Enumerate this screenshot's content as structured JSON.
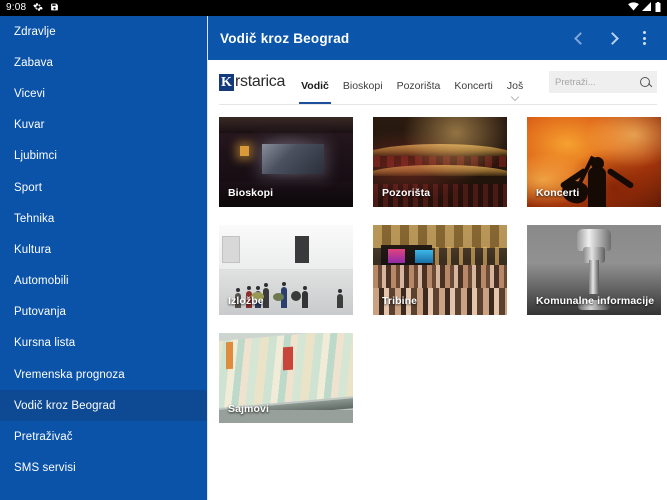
{
  "status_bar": {
    "time": "9:08",
    "left_icons": [
      "gear-icon",
      "save-icon"
    ],
    "right_icons": [
      "wifi-icon",
      "signal-icon",
      "battery-icon"
    ]
  },
  "app_bar": {
    "title": "Vodič kroz Beograd",
    "back_label": "‹",
    "forward_label": "›",
    "overflow_label": "more-options"
  },
  "colors": {
    "drawer_bg": "#0a53a8",
    "drawer_selected": "#0d4a93",
    "appbar_bg": "#0b55ab",
    "page_bg": "#ffffff",
    "logo_box": "#133a7c",
    "tab_underline": "#1c4f9c"
  },
  "sidebar": {
    "items": [
      {
        "label": "Zdravlje",
        "selected": false
      },
      {
        "label": "Zabava",
        "selected": false
      },
      {
        "label": "Vicevi",
        "selected": false
      },
      {
        "label": "Kuvar",
        "selected": false
      },
      {
        "label": "Ljubimci",
        "selected": false
      },
      {
        "label": "Sport",
        "selected": false
      },
      {
        "label": "Tehnika",
        "selected": false
      },
      {
        "label": "Kultura",
        "selected": false
      },
      {
        "label": "Automobili",
        "selected": false
      },
      {
        "label": "Putovanja",
        "selected": false
      },
      {
        "label": "Kursna lista",
        "selected": false
      },
      {
        "label": "Vremenska prognoza",
        "selected": false
      },
      {
        "label": "Vodič kroz Beograd",
        "selected": true
      },
      {
        "label": "Pretraživač",
        "selected": false
      },
      {
        "label": "SMS servisi",
        "selected": false
      }
    ]
  },
  "site": {
    "logo": {
      "mark": "K",
      "word": "rstarica"
    },
    "nav": [
      {
        "label": "Vodič",
        "active": true,
        "has_caret": false
      },
      {
        "label": "Bioskopi",
        "active": false,
        "has_caret": false
      },
      {
        "label": "Pozorišta",
        "active": false,
        "has_caret": false
      },
      {
        "label": "Koncerti",
        "active": false,
        "has_caret": false
      },
      {
        "label": "Još",
        "active": false,
        "has_caret": true
      }
    ],
    "search": {
      "placeholder": "Pretraži...",
      "value": "",
      "icon": "search-icon"
    }
  },
  "tiles": [
    {
      "label": "Bioskopi",
      "art": "art-cinema"
    },
    {
      "label": "Pozorišta",
      "art": "art-theatre"
    },
    {
      "label": "Koncerti",
      "art": "art-fire"
    },
    {
      "label": "Izložbe",
      "art": "art-gallery"
    },
    {
      "label": "Tribine",
      "art": "art-crowd"
    },
    {
      "label": "Komunalne informacije",
      "art": "art-tap"
    },
    {
      "label": "Sajmovi",
      "art": "art-books"
    }
  ]
}
